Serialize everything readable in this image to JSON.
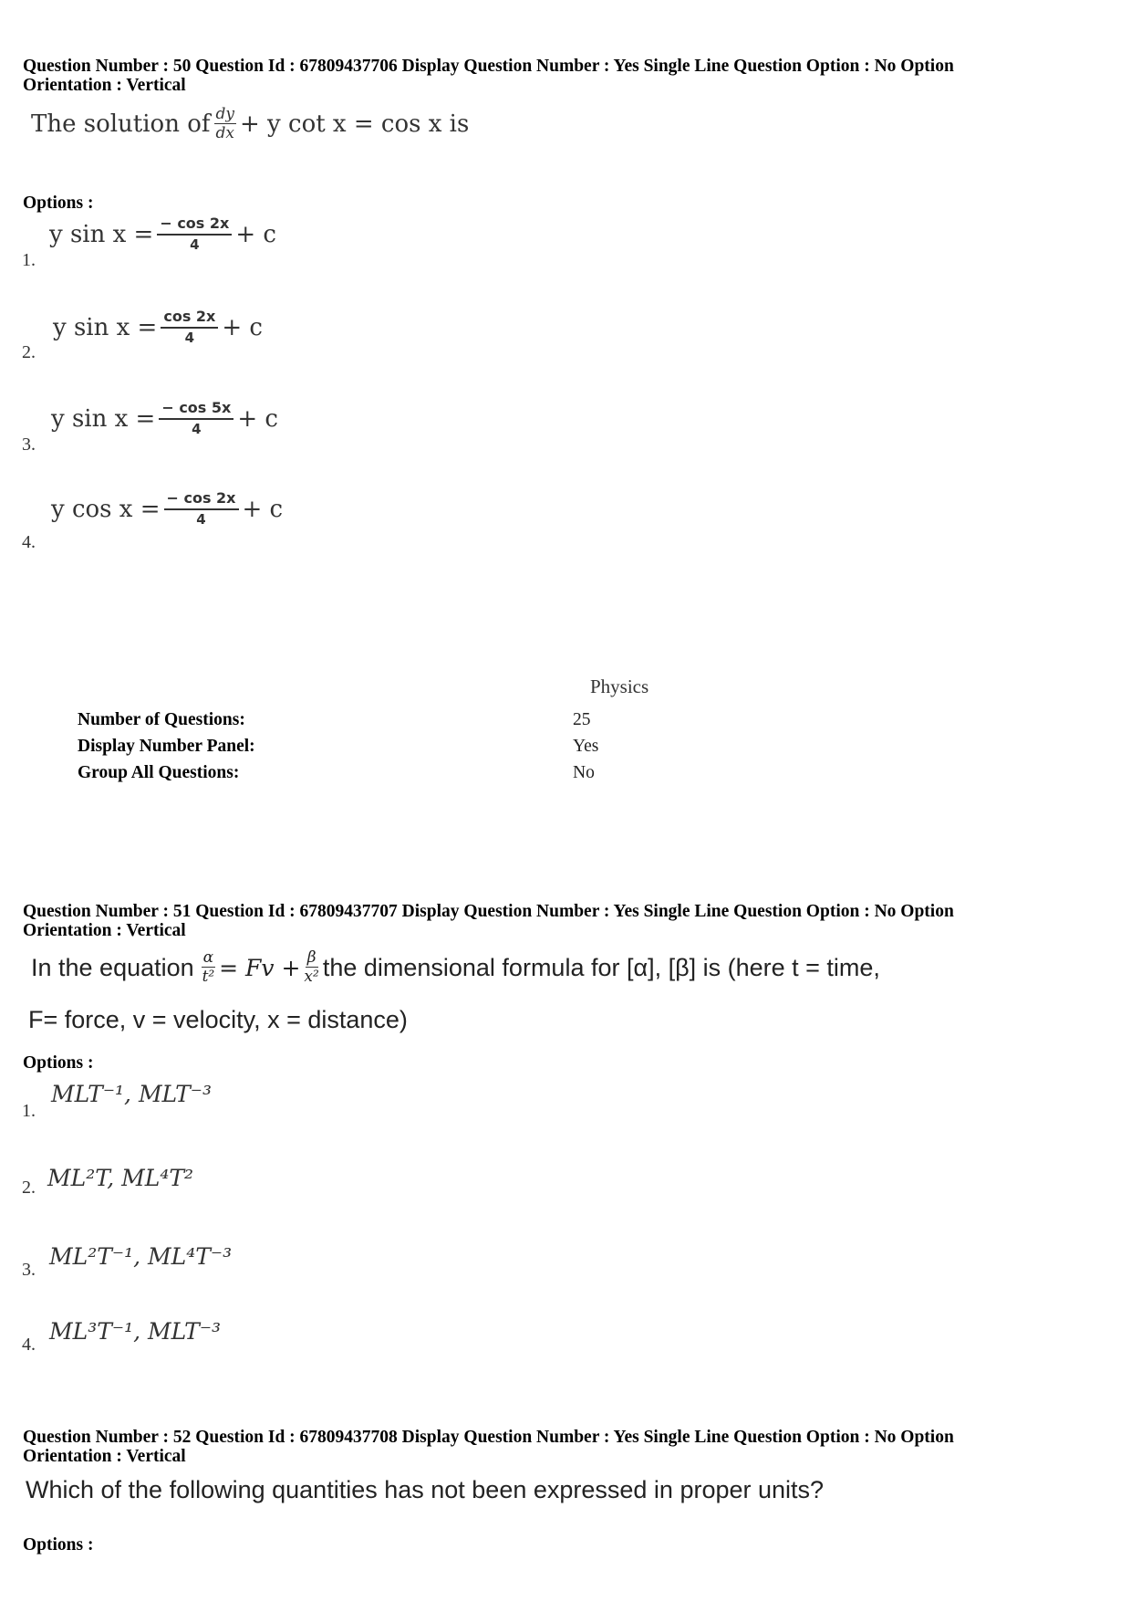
{
  "questions": [
    {
      "meta_line1": "Question Number : 50  Question Id : 67809437706  Display Question Number : Yes  Single Line Question Option : No  Option",
      "meta_line2": "Orientation : Vertical",
      "question_text": {
        "prefix": "The solution of",
        "frac_num": "dy",
        "frac_den": "dx",
        "suffix": "+ y cot x = cos x  is"
      },
      "options_label": "Options :",
      "options": [
        {
          "number": "1.",
          "lhs": "y sin x =",
          "num": "− cos 2x",
          "den": "4",
          "rhs": "+ c"
        },
        {
          "number": "2.",
          "lhs": "y sin x =",
          "num": "cos 2x",
          "den": "4",
          "rhs": "+ c"
        },
        {
          "number": "3.",
          "lhs": "y sin x =",
          "num": "− cos 5x",
          "den": "4",
          "rhs": "+ c"
        },
        {
          "number": "4.",
          "lhs": "y cos x =",
          "num": "− cos 2x",
          "den": "4",
          "rhs": "+ c"
        }
      ]
    },
    {
      "meta_line1": "Question Number : 51  Question Id : 67809437707  Display Question Number : Yes  Single Line Question Option : No  Option",
      "meta_line2": "Orientation : Vertical",
      "question_text": {
        "prefix": "In the equation",
        "frac1_num": "α",
        "frac1_den": "t²",
        "mid": "= Fv +",
        "frac2_num": "β",
        "frac2_den": "x²",
        "suffix": "the dimensional formula for [α], [β] is (here t = time,",
        "line2": "F= force, v = velocity, x = distance)"
      },
      "options_label": "Options :",
      "options": [
        {
          "number": "1.",
          "text": "MLT⁻¹, MLT⁻³"
        },
        {
          "number": "2.",
          "text": "ML²T, ML⁴T²"
        },
        {
          "number": "3.",
          "text": "ML²T⁻¹, ML⁴T⁻³"
        },
        {
          "number": "4.",
          "text": "ML³T⁻¹, MLT⁻³"
        }
      ]
    },
    {
      "meta_line1": "Question Number : 52  Question Id : 67809437708  Display Question Number : Yes  Single Line Question Option : No  Option",
      "meta_line2": "Orientation : Vertical",
      "question_text": "Which of the following quantities has not been expressed in proper units?",
      "options_label": "Options :"
    }
  ],
  "section": {
    "subject": "Physics",
    "rows": [
      {
        "label": "Number of Questions:",
        "value": "25"
      },
      {
        "label": "Display Number Panel:",
        "value": "Yes"
      },
      {
        "label": "Group All Questions:",
        "value": "No"
      }
    ]
  }
}
